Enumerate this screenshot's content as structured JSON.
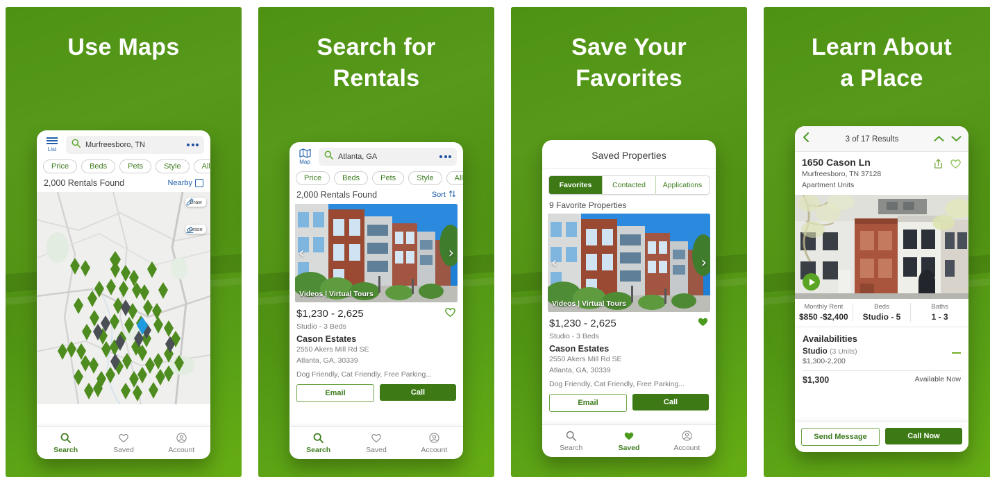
{
  "theme": {
    "green_bg": "#4e9214",
    "green_bright": "#66ad14",
    "brand_green": "#3d7a16",
    "accent_green": "#5aa423",
    "link_blue": "#1f5fa9",
    "pin_green": "#4e8c1f",
    "pin_grey": "#4a4f55",
    "pin_blue": "#1e9ae0"
  },
  "panels": [
    {
      "title": "Use Maps",
      "screen": "map",
      "search": {
        "mode_label": "List",
        "mode_icon": "list-icon",
        "value": "Murfreesboro, TN",
        "search_icon": "search-icon",
        "more_icon": "more-options-icon"
      },
      "chips": [
        "Price",
        "Beds",
        "Pets",
        "Style",
        "All"
      ],
      "results": {
        "count_label": "2,000 Rentals Found",
        "right_label": "Nearby",
        "right_icon": "nearby-box-icon"
      },
      "map_tools": [
        {
          "label": "Draw",
          "icon": "pencil-icon"
        },
        {
          "label": "Erase",
          "icon": "eraser-icon"
        }
      ],
      "nav": [
        {
          "label": "Search",
          "icon": "search-icon",
          "active": true
        },
        {
          "label": "Saved",
          "icon": "heart-icon",
          "active": false
        },
        {
          "label": "Account",
          "icon": "account-icon",
          "active": false
        }
      ]
    },
    {
      "title": "Search for\nRentals",
      "screen": "list",
      "search": {
        "mode_label": "Map",
        "mode_icon": "map-icon",
        "value": "Atlanta, GA",
        "search_icon": "search-icon",
        "more_icon": "more-options-icon"
      },
      "chips": [
        "Price",
        "Beds",
        "Pets",
        "Style",
        "All"
      ],
      "results": {
        "count_label": "2,000 Rentals Found",
        "right_label": "Sort",
        "right_icon": "sort-arrows-icon"
      },
      "listing": {
        "photo_tag": "Videos  |  Virtual Tours",
        "prev_icon": "chevron-left-icon",
        "next_icon": "chevron-right-icon",
        "price": "$1,230 - 2,625",
        "favorite_icon": "heart-outline-icon",
        "beds": "Studio - 3 Beds",
        "name": "Cason Estates",
        "address_line1": "2550 Akers Mill Rd SE",
        "address_line2": "Atlanta, GA, 30339",
        "amenities": "Dog Friendly, Cat Friendly, Free Parking...",
        "btn_secondary": "Email",
        "btn_primary": "Call"
      },
      "nav": [
        {
          "label": "Search",
          "icon": "search-icon",
          "active": true
        },
        {
          "label": "Saved",
          "icon": "heart-icon",
          "active": false
        },
        {
          "label": "Account",
          "icon": "account-icon",
          "active": false
        }
      ]
    },
    {
      "title": "Save Your\nFavorites",
      "screen": "saved",
      "header": "Saved Properties",
      "tabs": [
        {
          "label": "Favorites",
          "active": true
        },
        {
          "label": "Contacted",
          "active": false
        },
        {
          "label": "Applications",
          "active": false
        }
      ],
      "fav_count": "9 Favorite Properties",
      "listing": {
        "photo_tag": "Videos  |  Virtual Tours",
        "prev_icon": "chevron-left-icon",
        "next_icon": "chevron-right-icon",
        "price": "$1,230 - 2,625",
        "favorite_icon": "heart-filled-icon",
        "beds": "Studio - 3 Beds",
        "name": "Cason Estates",
        "address_line1": "2550 Akers Mill Rd SE",
        "address_line2": "Atlanta, GA, 30339",
        "amenities": "Dog Friendly, Cat Friendly, Free Parking...",
        "btn_secondary": "Email",
        "btn_primary": "Call"
      },
      "nav": [
        {
          "label": "Search",
          "icon": "search-icon",
          "active": false
        },
        {
          "label": "Saved",
          "icon": "heart-filled-icon",
          "active": true
        },
        {
          "label": "Account",
          "icon": "account-icon",
          "active": false
        }
      ]
    },
    {
      "title": "Learn About\na Place",
      "screen": "detail",
      "topbar": {
        "back_icon": "chevron-left-icon",
        "results_label": "3 of 17 Results",
        "up_icon": "chevron-up-icon",
        "down_icon": "chevron-down-icon"
      },
      "header": {
        "title": "1650 Cason Ln",
        "sub1": "Murfreesboro, TN 37128",
        "sub2": "Apartment Units",
        "share_icon": "share-icon",
        "favorite_icon": "heart-outline-icon"
      },
      "hero": {
        "play_icon": "play-icon"
      },
      "stats": [
        {
          "key": "Monthly Rent",
          "value": "$850 -$2,400"
        },
        {
          "key": "Beds",
          "value": "Studio - 5"
        },
        {
          "key": "Baths",
          "value": "1 - 3"
        }
      ],
      "availabilities": {
        "title": "Availabilities",
        "unit_type": "Studio",
        "unit_count": "(3 Units)",
        "range": "$1,300-2,200",
        "collapse_icon": "minus-icon",
        "row_price": "$1,300",
        "row_status": "Available Now"
      },
      "cta": {
        "secondary": "Send Message",
        "primary": "Call Now"
      }
    }
  ]
}
